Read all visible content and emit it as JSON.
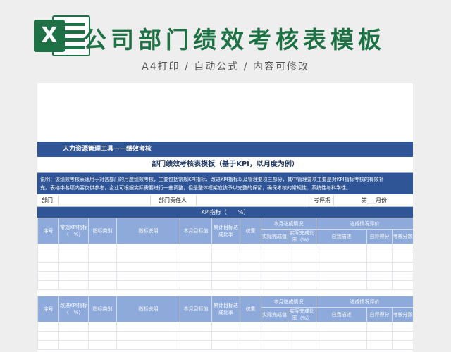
{
  "banner": {
    "logo_letter": "X",
    "title": "公司部门绩效考核表模板",
    "subtitle": "A4打印 / 自动公式 / 内容可修改"
  },
  "sheet": {
    "tool_title": "人力资源管理工具——绩效考核",
    "table_title": "部门绩效考核表模板（基于KPI，以月度为例）",
    "description_line1": "说明：该绩效考核表适用于对各部门的月度绩效考核，主要包括常规KPI指标、改进KPI指标以及管理要项三部分，其中管理要项主要是对KPI指标考核的有效补",
    "description_line2": "充。表格中各项内容仅供参考，企业可根据实际需要进行一些调整，但是整体框架应该予以完整的保留，确保考核的常规性、系统性与科学性。",
    "dept_label": "部门",
    "manager_label": "部门责任人",
    "period_label": "考评期",
    "month_label": "第___月份",
    "kpi_bar": "KPI指标（　　%）",
    "headers": {
      "seq": "序号",
      "regular_kpi": "常规KPI指标（　%）",
      "improve_kpi": "改进KPI指标（　%）",
      "category": "指标类别",
      "explain": "指标说明",
      "target": "本月目标值",
      "cumulative": "累计目标达成比率",
      "weight": "权重",
      "status_group": "本月达成情况",
      "actual": "实际完成值",
      "actual_rate": "实际完成比率（%）",
      "eval_group": "达成情况评价",
      "self_desc": "自我描述",
      "self_score": "自评得分",
      "score": "考核分数"
    }
  },
  "colors": {
    "brand_green": "#1e7145",
    "header_dark": "#2f5597",
    "header_light": "#8eaadb"
  }
}
